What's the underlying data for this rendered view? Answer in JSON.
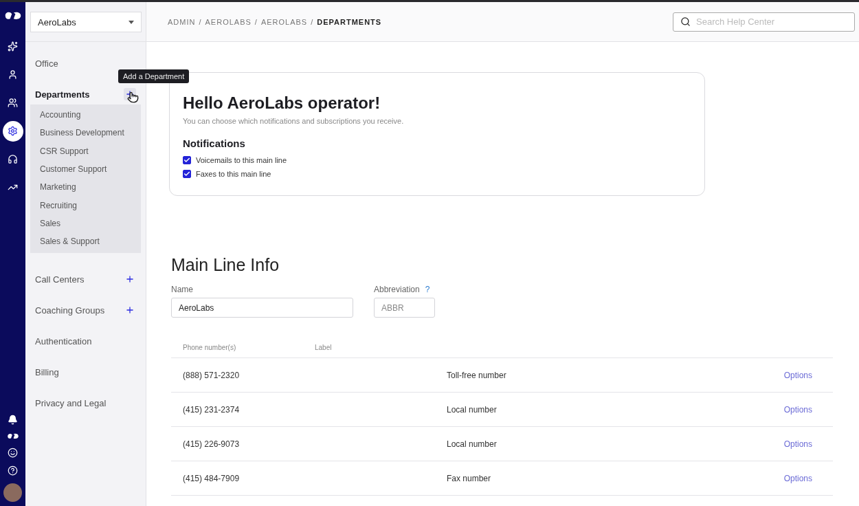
{
  "rail": {
    "top": [
      {
        "kind": "sparkle",
        "selected": false
      },
      {
        "kind": "person",
        "selected": false
      },
      {
        "kind": "team",
        "selected": false
      },
      {
        "kind": "gear",
        "selected": true
      },
      {
        "kind": "headset",
        "selected": false
      },
      {
        "kind": "trend",
        "selected": false
      }
    ],
    "bottom": [
      {
        "kind": "bell"
      },
      {
        "kind": "logo"
      },
      {
        "kind": "smile"
      },
      {
        "kind": "help"
      },
      {
        "kind": "avatar"
      }
    ]
  },
  "company_select": {
    "value": "AeroLabs"
  },
  "sidebar": {
    "items": [
      {
        "label": "Office",
        "selected": false,
        "add": false
      },
      {
        "label": "Departments",
        "selected": true,
        "add": true,
        "hovered": true,
        "children": [
          {
            "label": "Accounting"
          },
          {
            "label": "Business Development"
          },
          {
            "label": "CSR Support"
          },
          {
            "label": "Customer Support"
          },
          {
            "label": "Marketing"
          },
          {
            "label": "Recruiting"
          },
          {
            "label": "Sales"
          },
          {
            "label": "Sales & Support"
          }
        ]
      },
      {
        "label": "Call Centers",
        "selected": false,
        "add": true
      },
      {
        "label": "Coaching Groups",
        "selected": false,
        "add": true
      },
      {
        "label": "Authentication",
        "selected": false,
        "add": false
      },
      {
        "label": "Billing",
        "selected": false,
        "add": false
      },
      {
        "label": "Privacy and Legal",
        "selected": false,
        "add": false
      }
    ]
  },
  "tooltip": {
    "text": "Add a Department"
  },
  "breadcrumb": [
    {
      "label": "ADMIN",
      "current": false
    },
    {
      "label": "AEROLABS",
      "current": false
    },
    {
      "label": "AEROLABS",
      "current": false
    },
    {
      "label": "DEPARTMENTS",
      "current": true
    }
  ],
  "breadcrumb_separator": "/",
  "search": {
    "placeholder": "Search Help Center"
  },
  "greeting": {
    "title": "Hello AeroLabs operator!",
    "subtitle": "You can choose which notifications and subscriptions you receive.",
    "section": "Notifications",
    "options": [
      {
        "label": "Voicemails to this main line",
        "checked": true
      },
      {
        "label": "Faxes to this main line",
        "checked": true
      }
    ]
  },
  "main_line": {
    "title": "Main Line Info",
    "name_label": "Name",
    "name_value": "AeroLabs",
    "abbr_label": "Abbreviation",
    "abbr_help": "?",
    "abbr_placeholder": "ABBR",
    "columns": [
      "Phone number(s)",
      "Label"
    ],
    "rows": [
      {
        "number": "(888) 571-2320",
        "label": "Toll-free number",
        "action": "Options"
      },
      {
        "number": "(415) 231-2374",
        "label": "Local number",
        "action": "Options"
      },
      {
        "number": "(415) 226-9073",
        "label": "Local number",
        "action": "Options"
      },
      {
        "number": "(415) 484-7909",
        "label": "Fax number",
        "action": "Options"
      }
    ]
  }
}
